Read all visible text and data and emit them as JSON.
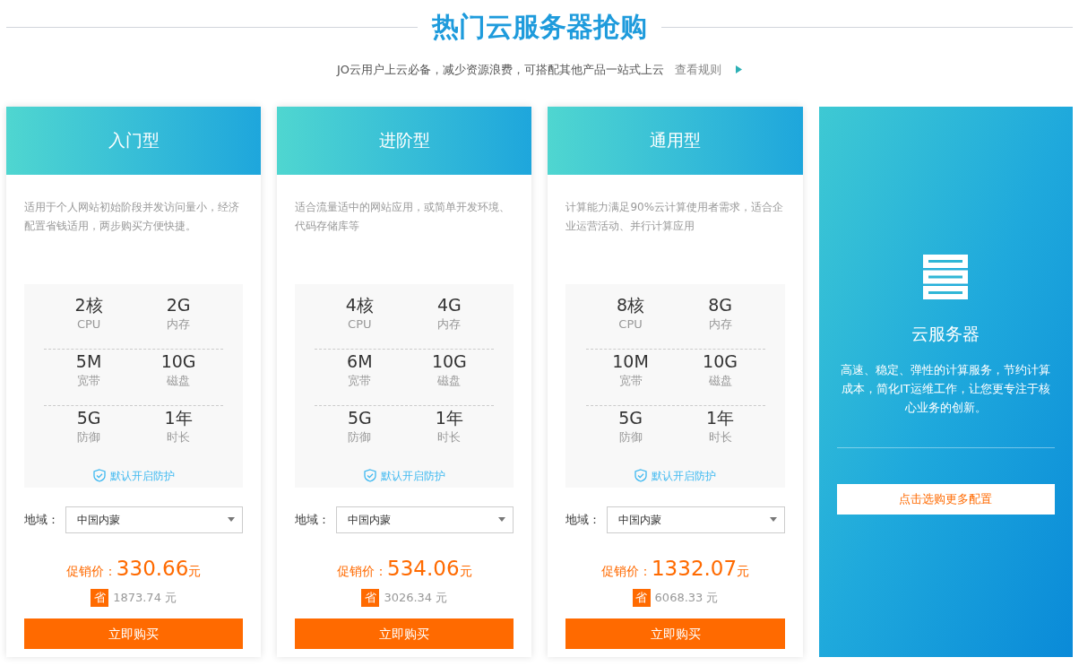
{
  "heading": {
    "title": "热门云服务器抢购",
    "subtitle": "JO云用户上云必备，减少资源浪费，可搭配其他产品一站式上云",
    "rules_link": "查看规则"
  },
  "plans": [
    {
      "name": "入门型",
      "description": "适用于个人网站初始阶段并发访问量小，经济配置省钱适用，两步购买方便快捷。",
      "specs": [
        {
          "value": "2核",
          "label": "CPU"
        },
        {
          "value": "2G",
          "label": "内存"
        },
        {
          "value": "5M",
          "label": "宽带"
        },
        {
          "value": "10G",
          "label": "磁盘"
        },
        {
          "value": "5G",
          "label": "防御"
        },
        {
          "value": "1年",
          "label": "时长"
        }
      ],
      "protection": "默认开启防护",
      "region_label": "地域：",
      "region": "中国内蒙",
      "price_label": "促销价：",
      "price": "330.66",
      "price_unit": "元",
      "save_badge": "省",
      "saving": "1873.74 元",
      "buy": "立即购买"
    },
    {
      "name": "进阶型",
      "description": "适合流量适中的网站应用，或简单开发环境、代码存储库等",
      "specs": [
        {
          "value": "4核",
          "label": "CPU"
        },
        {
          "value": "4G",
          "label": "内存"
        },
        {
          "value": "6M",
          "label": "宽带"
        },
        {
          "value": "10G",
          "label": "磁盘"
        },
        {
          "value": "5G",
          "label": "防御"
        },
        {
          "value": "1年",
          "label": "时长"
        }
      ],
      "protection": "默认开启防护",
      "region_label": "地域：",
      "region": "中国内蒙",
      "price_label": "促销价：",
      "price": "534.06",
      "price_unit": "元",
      "save_badge": "省",
      "saving": "3026.34 元",
      "buy": "立即购买"
    },
    {
      "name": "通用型",
      "description": "计算能力满足90%云计算使用者需求，适合企业运营活动、并行计算应用",
      "specs": [
        {
          "value": "8核",
          "label": "CPU"
        },
        {
          "value": "8G",
          "label": "内存"
        },
        {
          "value": "10M",
          "label": "宽带"
        },
        {
          "value": "10G",
          "label": "磁盘"
        },
        {
          "value": "5G",
          "label": "防御"
        },
        {
          "value": "1年",
          "label": "时长"
        }
      ],
      "protection": "默认开启防护",
      "region_label": "地域：",
      "region": "中国内蒙",
      "price_label": "促销价：",
      "price": "1332.07",
      "price_unit": "元",
      "save_badge": "省",
      "saving": "6068.33 元",
      "buy": "立即购买"
    }
  ],
  "promo": {
    "title": "云服务器",
    "description": "高速、稳定、弹性的计算服务，节约计算成本，简化IT运维工作，让您更专注于核心业务的创新。",
    "button": "点击选购更多配置"
  }
}
